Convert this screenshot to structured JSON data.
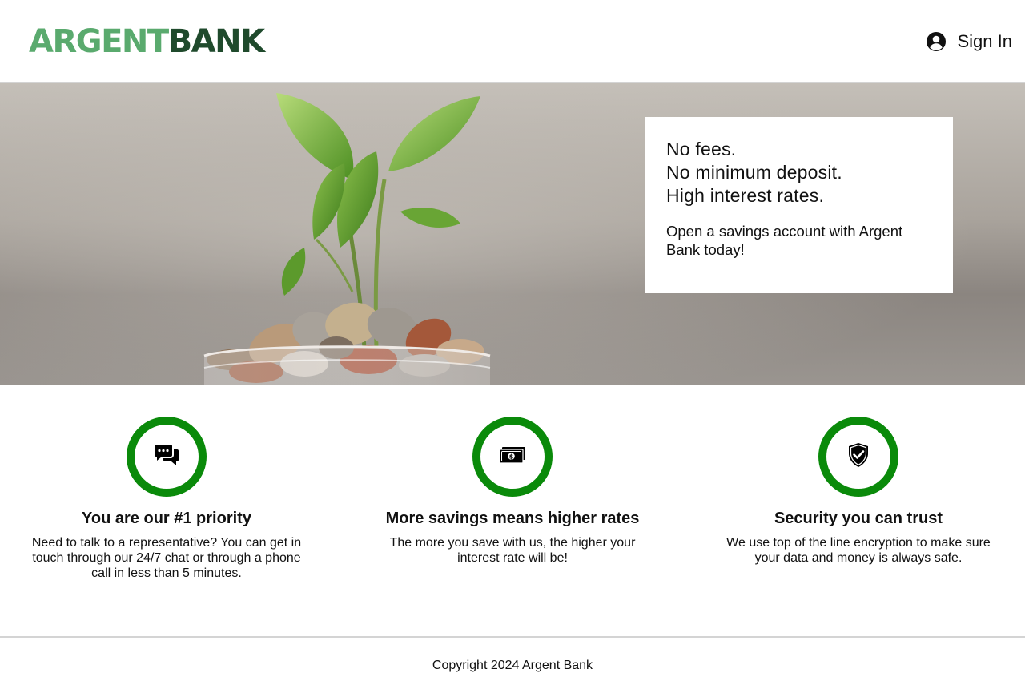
{
  "header": {
    "logo": {
      "part1": "ARGENT",
      "part2": "BANK"
    },
    "signin_label": "Sign In",
    "signin_icon": "user-circle-icon"
  },
  "hero": {
    "image": "plant-growing-from-coins-in-glass-jar",
    "promo": {
      "lines": [
        "No fees.",
        "No minimum deposit.",
        "High interest rates."
      ],
      "subtext": "Open a savings account with Argent Bank today!"
    }
  },
  "features": [
    {
      "icon": "chat-icon",
      "title": "You are our #1 priority",
      "description": "Need to talk to a representative? You can get in touch through our 24/7 chat or through a phone call in less than 5 minutes."
    },
    {
      "icon": "money-bill-icon",
      "title": "More savings means higher rates",
      "description": "The more you save with us, the higher your interest rate will be!"
    },
    {
      "icon": "shield-check-icon",
      "title": "Security you can trust",
      "description": "We use top of the line encryption to make sure your data and money is always safe."
    }
  ],
  "footer": {
    "copyright": "Copyright 2024 Argent Bank"
  },
  "colors": {
    "logo_light": "#5aaa6e",
    "logo_dark": "#1f4a2c",
    "accent_green": "#0a8a0a"
  }
}
